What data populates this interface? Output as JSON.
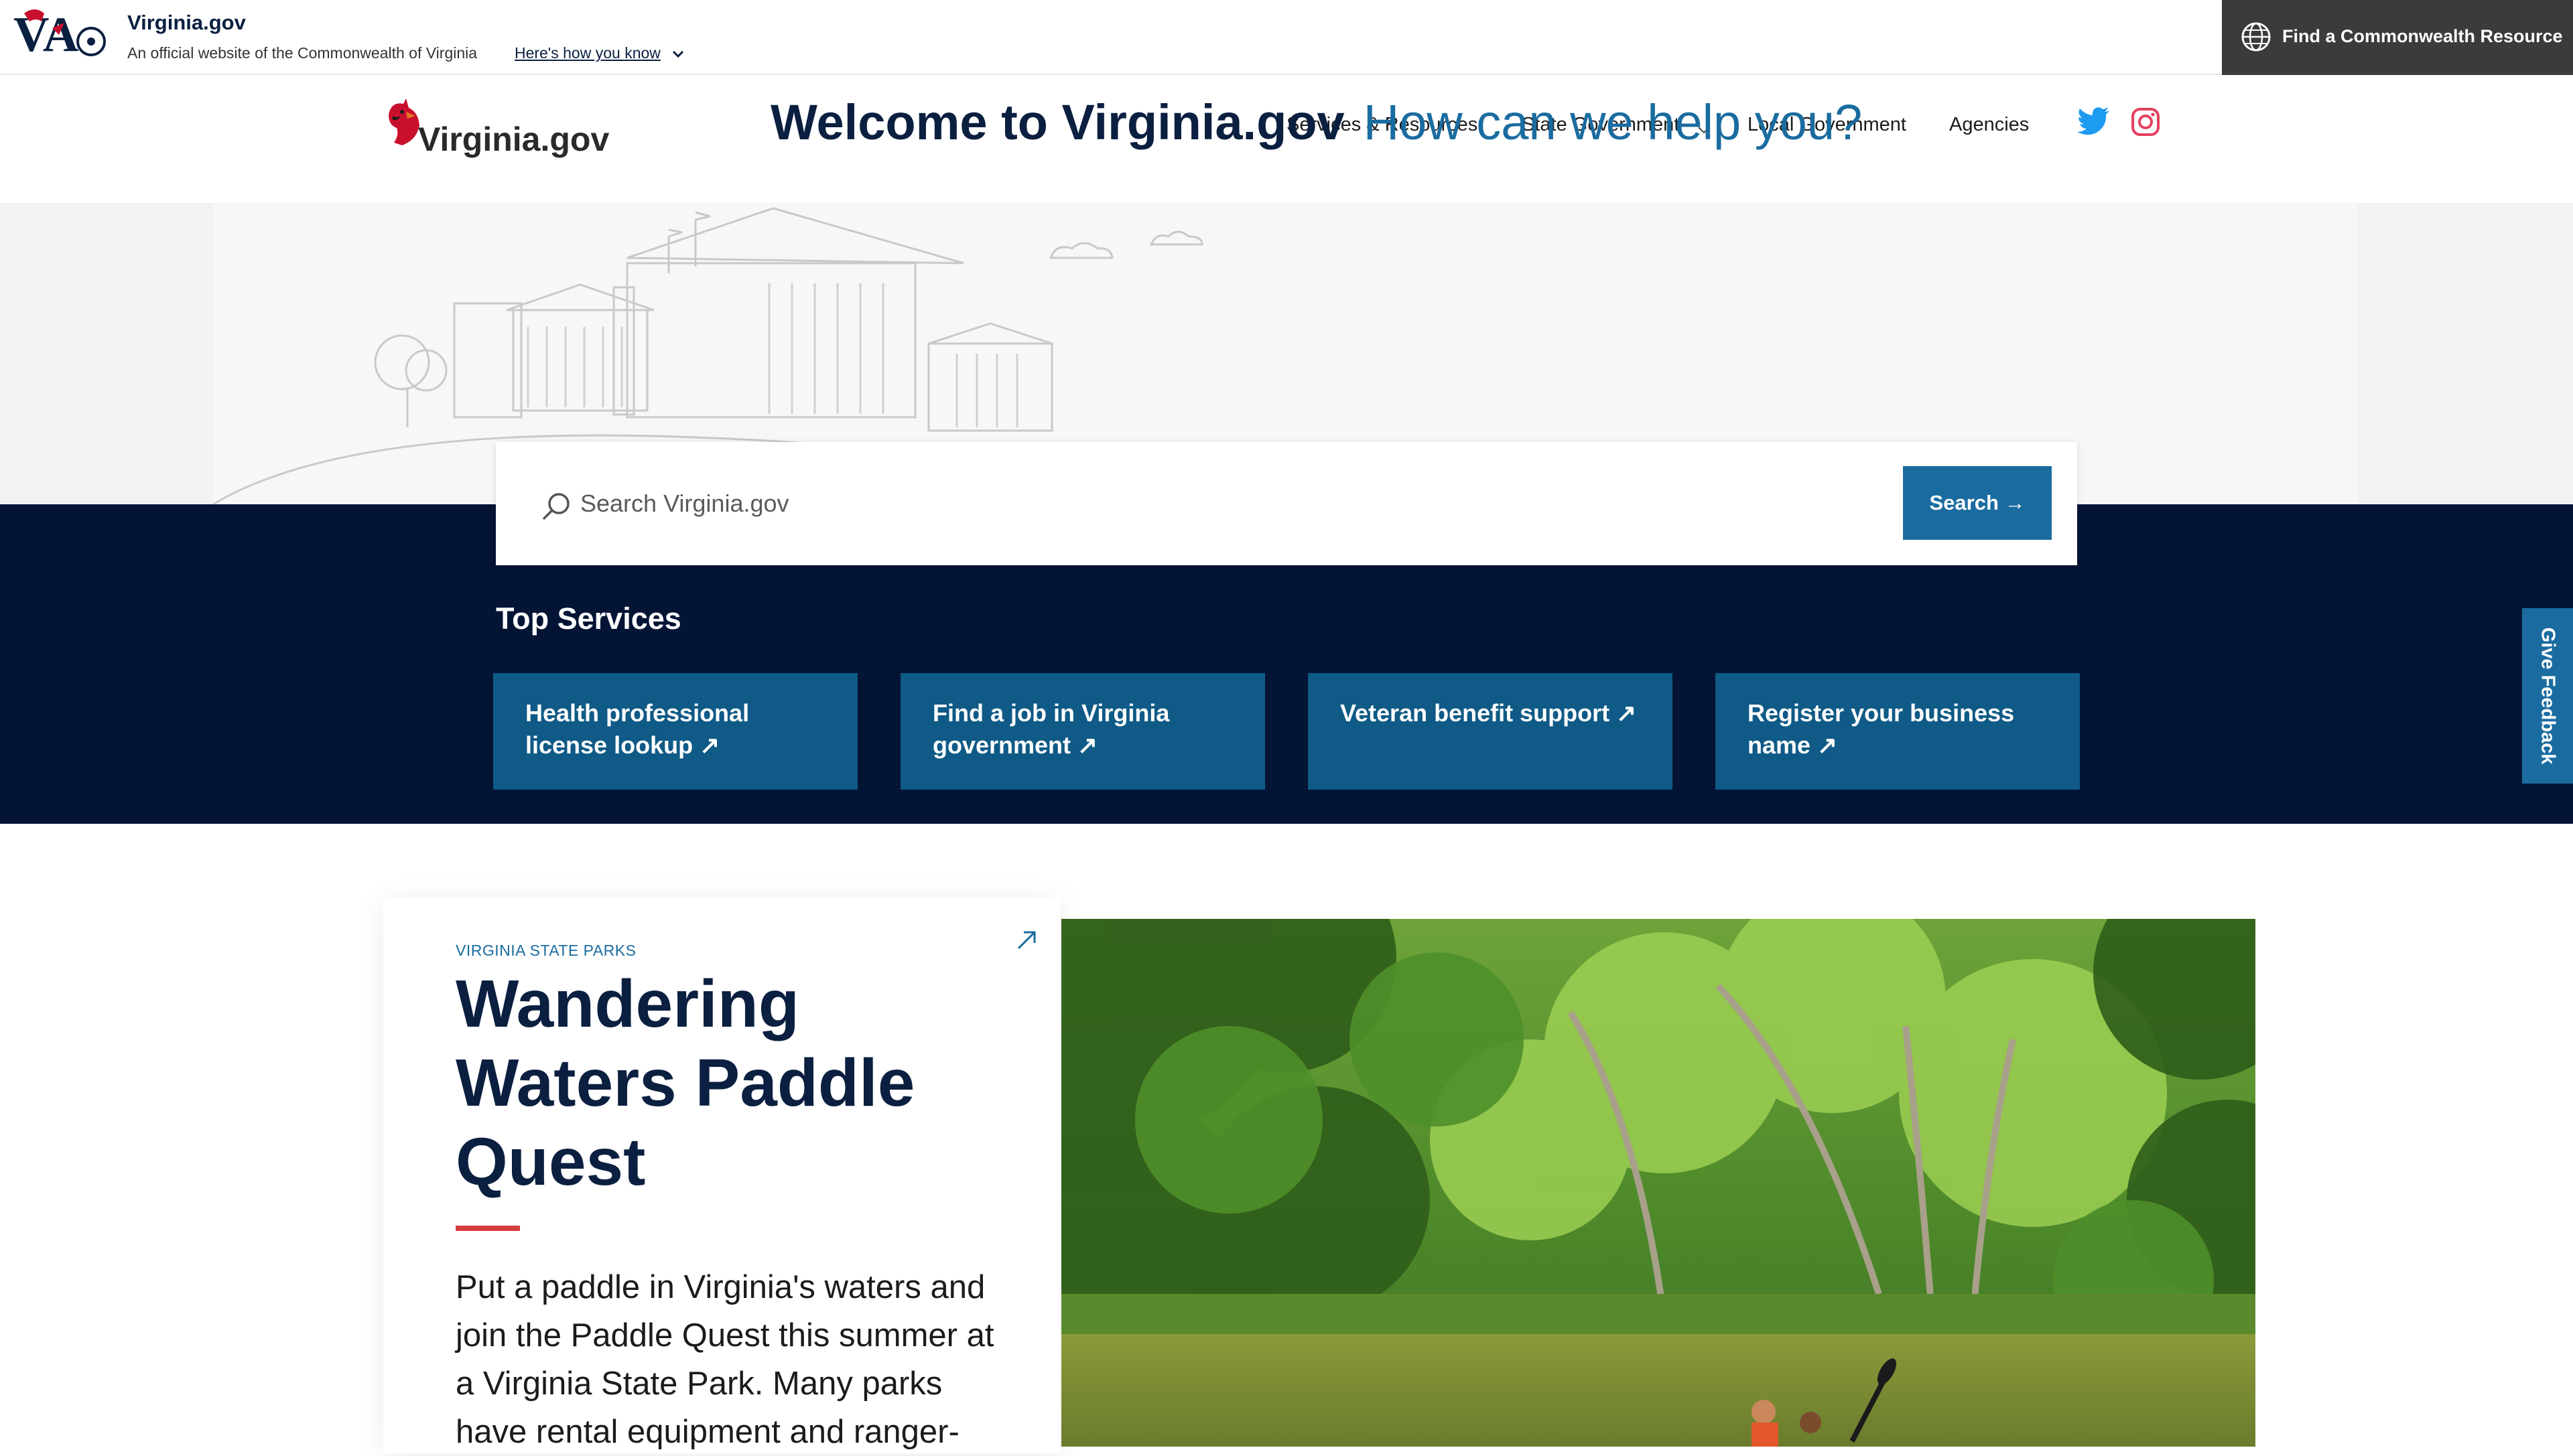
{
  "banner": {
    "title": "Virginia.gov",
    "subtitle": "An official website of the Commonwealth of Virginia",
    "how_link": "Here's how you know",
    "find_resource": "Find a Commonwealth Resource"
  },
  "header": {
    "logo_text": "Virginia.gov",
    "nav": [
      {
        "label": "Services & Resources"
      },
      {
        "label": "State Government"
      },
      {
        "label": "Local Government"
      },
      {
        "label": "Agencies"
      }
    ],
    "social": [
      "twitter-icon",
      "instagram-icon"
    ]
  },
  "hero": {
    "welcome": "Welcome to Virginia.gov",
    "help": "How can we help you?"
  },
  "search": {
    "placeholder": "Search Virginia.gov",
    "button_label": "Search →"
  },
  "top_services": {
    "title": "Top Services",
    "items": [
      {
        "label": "Health professional license lookup ↗"
      },
      {
        "label": "Find a job in Virginia government ↗"
      },
      {
        "label": "Veteran benefit support ↗"
      },
      {
        "label": "Register your business name ↗"
      }
    ]
  },
  "feedback": {
    "label": "Give Feedback"
  },
  "feature": {
    "tag": "VIRGINIA STATE PARKS",
    "title": "Wandering Waters Paddle Quest",
    "description": "Put a paddle in Virginia's waters and join the Paddle Quest this summer at a Virginia State Park. Many parks have rental equipment and ranger-"
  },
  "colors": {
    "navy": "#0b1f40",
    "dark_band": "#041434",
    "accent_blue": "#1a6ca0",
    "tile_blue": "#0f5a86",
    "accent_red": "#d63e3e"
  }
}
